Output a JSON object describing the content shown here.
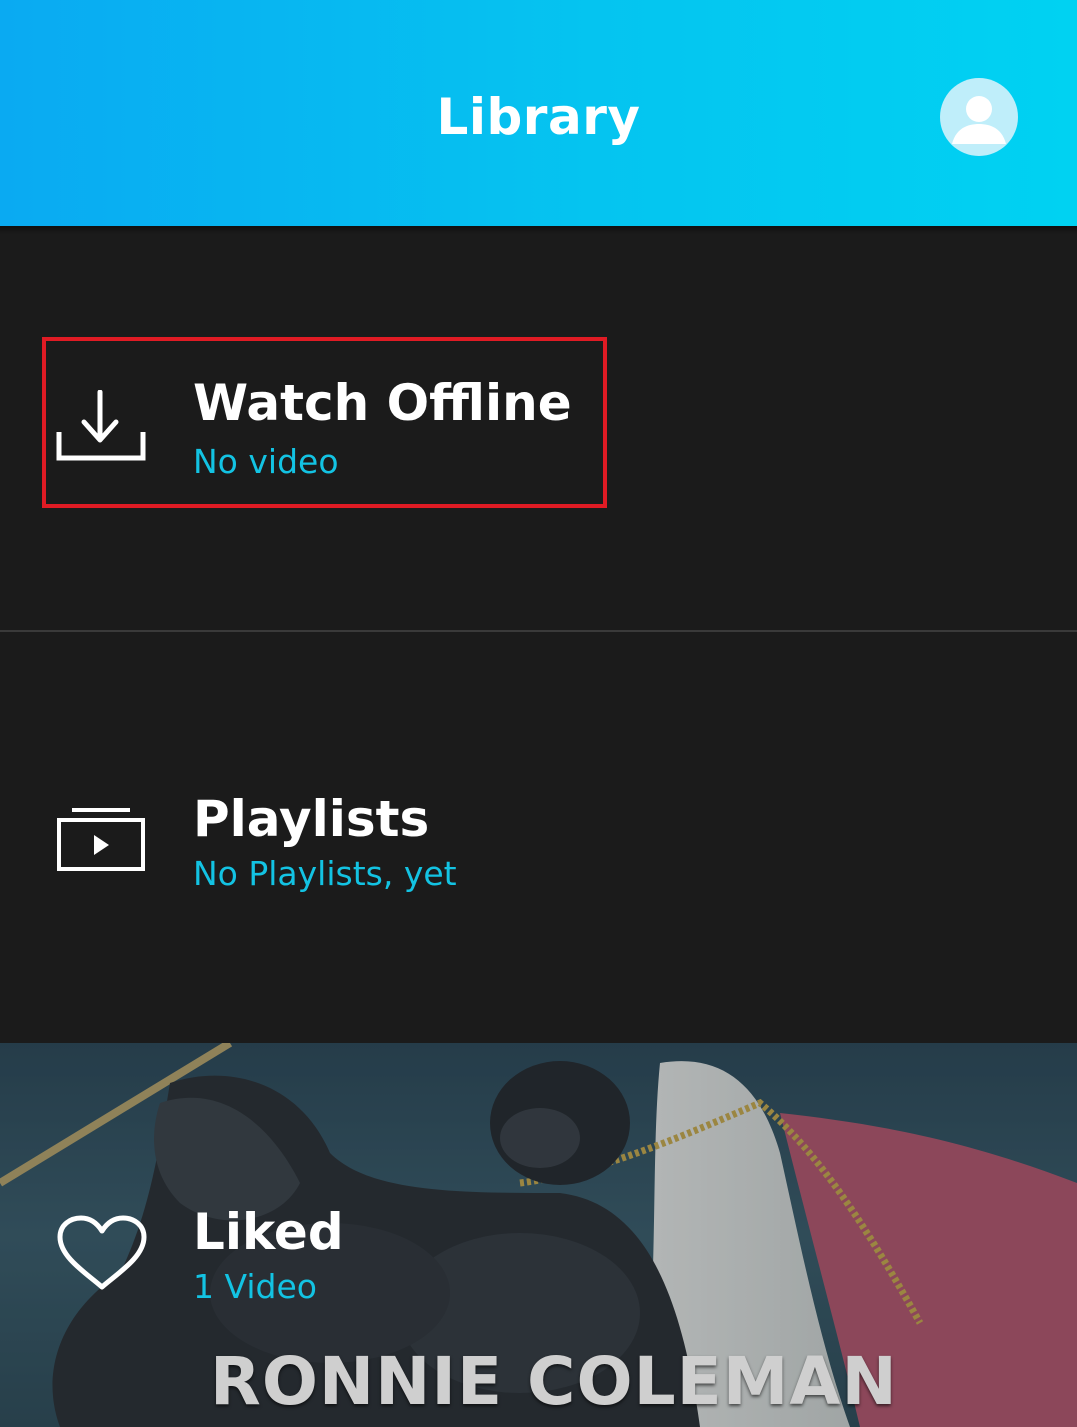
{
  "header": {
    "title": "Library",
    "profile_icon": "user-avatar-icon"
  },
  "library": {
    "items": [
      {
        "title": "Watch Offline",
        "subtitle": "No video",
        "icon": "download-icon"
      },
      {
        "title": "Playlists",
        "subtitle": "No Playlists, yet",
        "icon": "playlist-icon"
      },
      {
        "title": "Liked",
        "subtitle": "1 Video",
        "icon": "heart-icon",
        "thumbnail_caption": "RONNIE COLEMAN"
      }
    ]
  },
  "colors": {
    "header_gradient_start": "#0aaaf2",
    "header_gradient_end": "#00d2f2",
    "background": "#1b1b1b",
    "subtitle": "#13c3e3",
    "highlight": "#e01b24"
  }
}
